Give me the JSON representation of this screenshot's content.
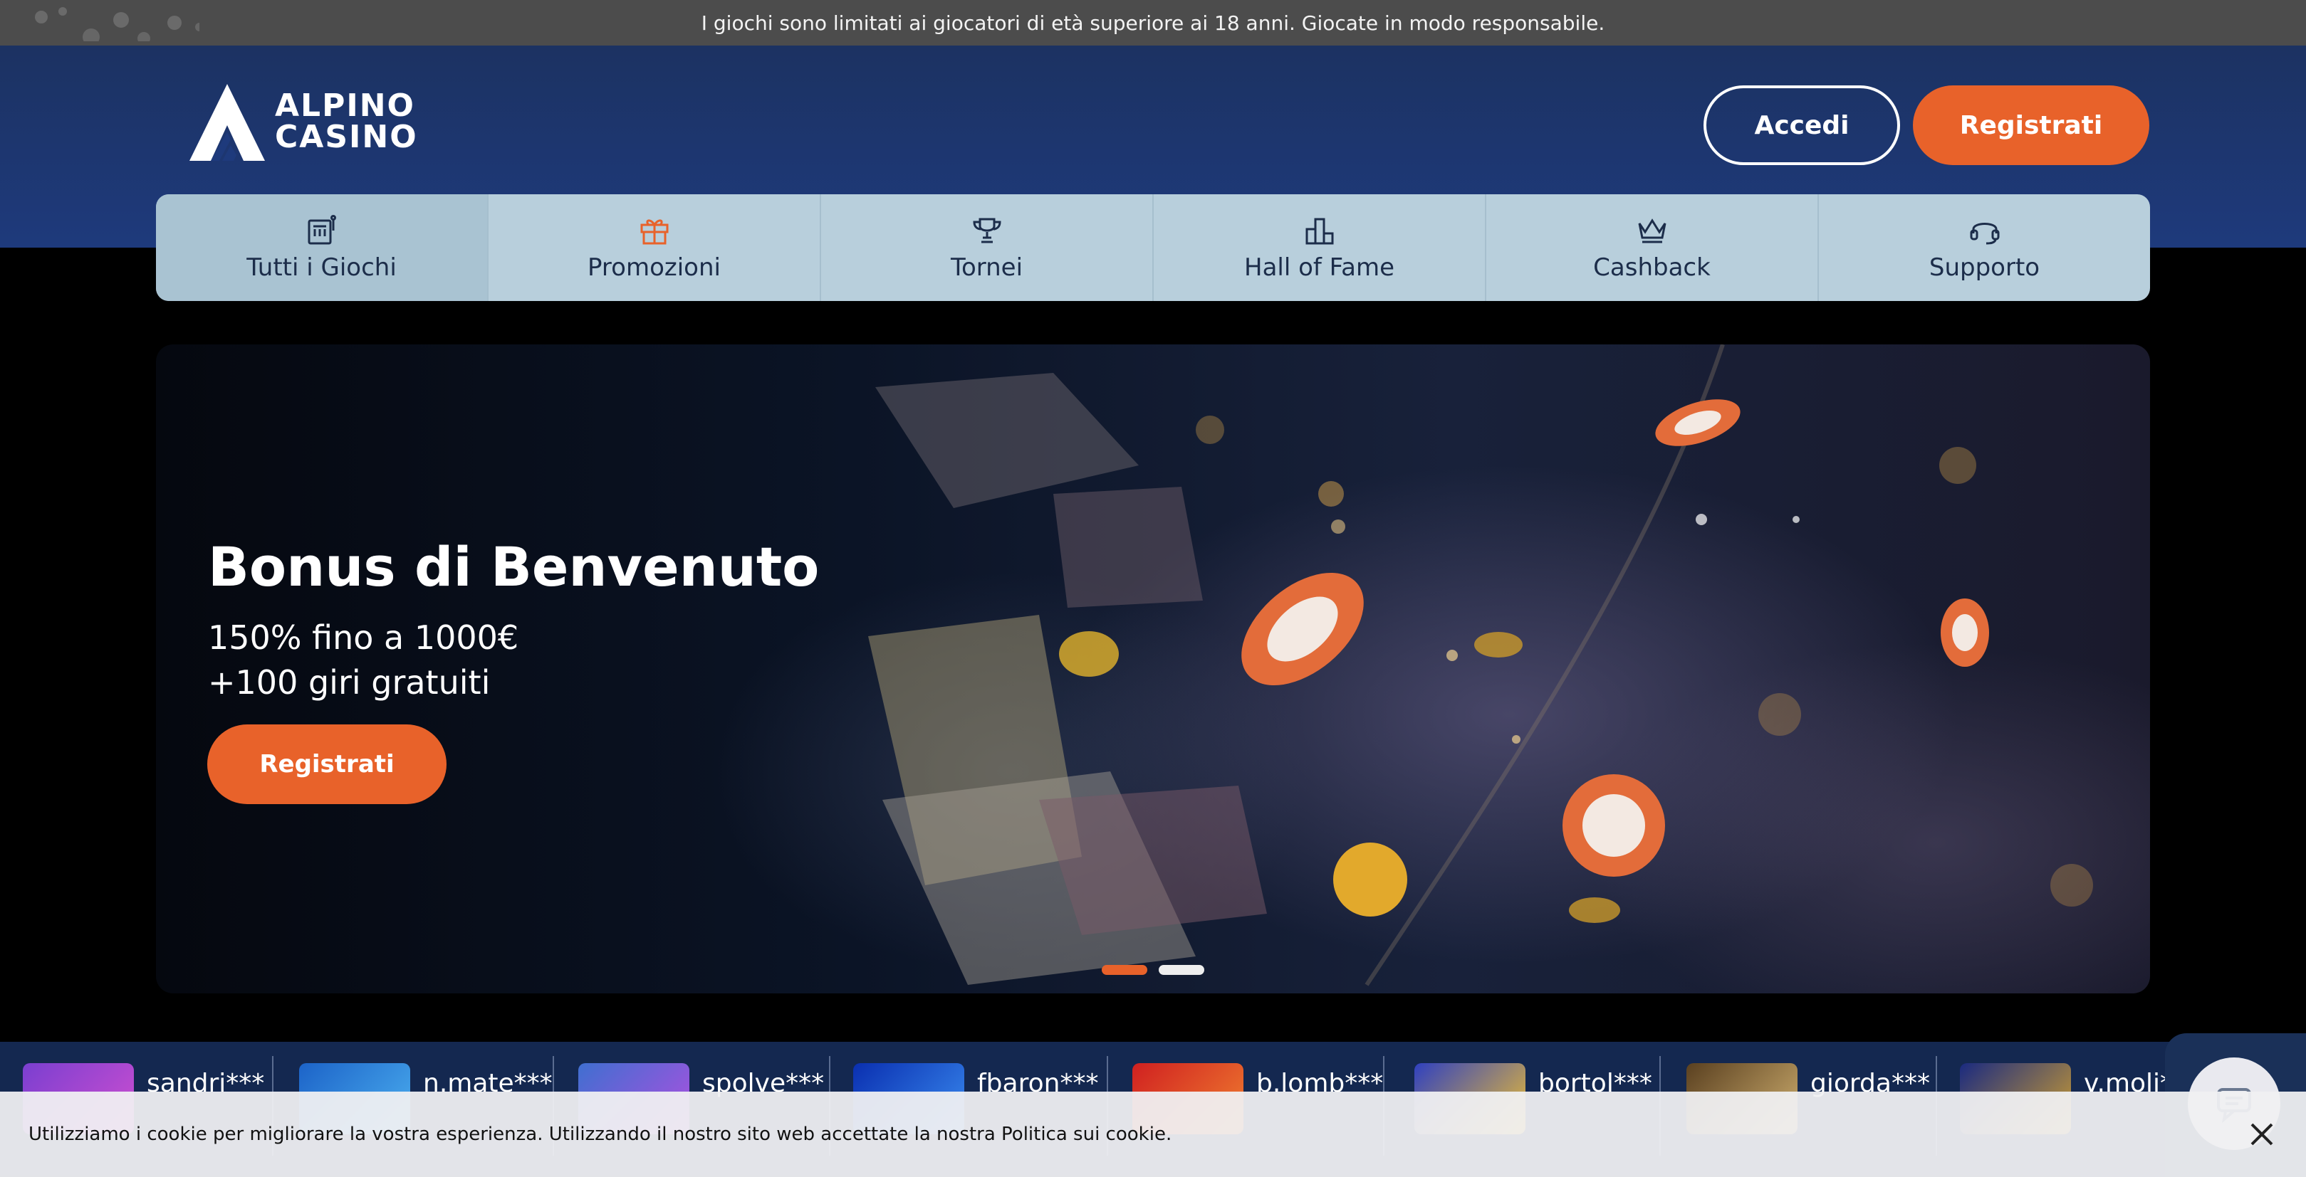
{
  "notice": {
    "text": "I giochi sono limitati ai giocatori di età superiore ai 18 anni. Giocate in modo responsabile."
  },
  "header": {
    "logo_line1": "ALPINO",
    "logo_line2": "CASINO",
    "login_label": "Accedi",
    "register_label": "Registrati"
  },
  "nav": {
    "items": [
      {
        "label": "Tutti i Giochi",
        "icon": "slot-machine-icon",
        "active": true
      },
      {
        "label": "Promozioni",
        "icon": "gift-icon"
      },
      {
        "label": "Tornei",
        "icon": "trophy-icon"
      },
      {
        "label": "Hall of Fame",
        "icon": "podium-icon"
      },
      {
        "label": "Cashback",
        "icon": "crown-icon"
      },
      {
        "label": "Supporto",
        "icon": "headset-icon"
      }
    ]
  },
  "hero": {
    "title": "Bonus di Benvenuto",
    "subtitle_line1": "150% fino a 1000€",
    "subtitle_line2": "+100 giri gratuiti",
    "cta_label": "Registrati",
    "slides_total": 2,
    "active_slide": 1
  },
  "ticker": {
    "winners": [
      {
        "name": "sandri***"
      },
      {
        "name": "n.mate***"
      },
      {
        "name": "spolve***"
      },
      {
        "name": "fbaron***"
      },
      {
        "name": "b.lomb***"
      },
      {
        "name": "bortol***"
      },
      {
        "name": "giorda***"
      },
      {
        "name": "v.moli***"
      }
    ]
  },
  "cookie": {
    "text": "Utilizziamo i cookie per migliorare la vostra esperienza. Utilizzando il nostro sito web accettate la nostra Politica sui cookie."
  },
  "colors": {
    "accent": "#e8622a",
    "header_bg": "#1e3a7c",
    "nav_bg": "#b8cfdc",
    "notice_bg": "#4c4c4c"
  }
}
